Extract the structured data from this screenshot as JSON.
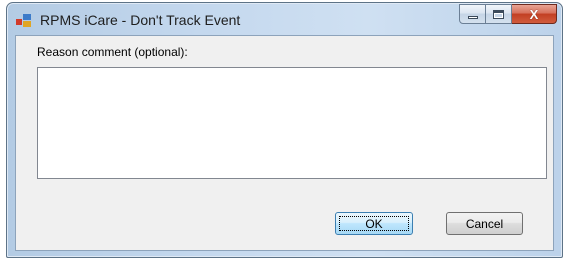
{
  "window": {
    "title": "RPMS iCare - Don't Track Event",
    "icon": "rpms-app-icon",
    "controls": {
      "minimize_icon": "minimize-icon",
      "maximize_icon": "maximize-icon",
      "close_icon": "close-icon",
      "close_glyph": "X"
    }
  },
  "form": {
    "reason_label": "Reason comment (optional):",
    "reason_value": "",
    "ok_label": "OK",
    "cancel_label": "Cancel"
  },
  "colors": {
    "title_bar": "#c4d8ee",
    "client_bg": "#f0f0f0",
    "close_button": "#c23f23",
    "default_button_border": "#3c7fb1"
  }
}
